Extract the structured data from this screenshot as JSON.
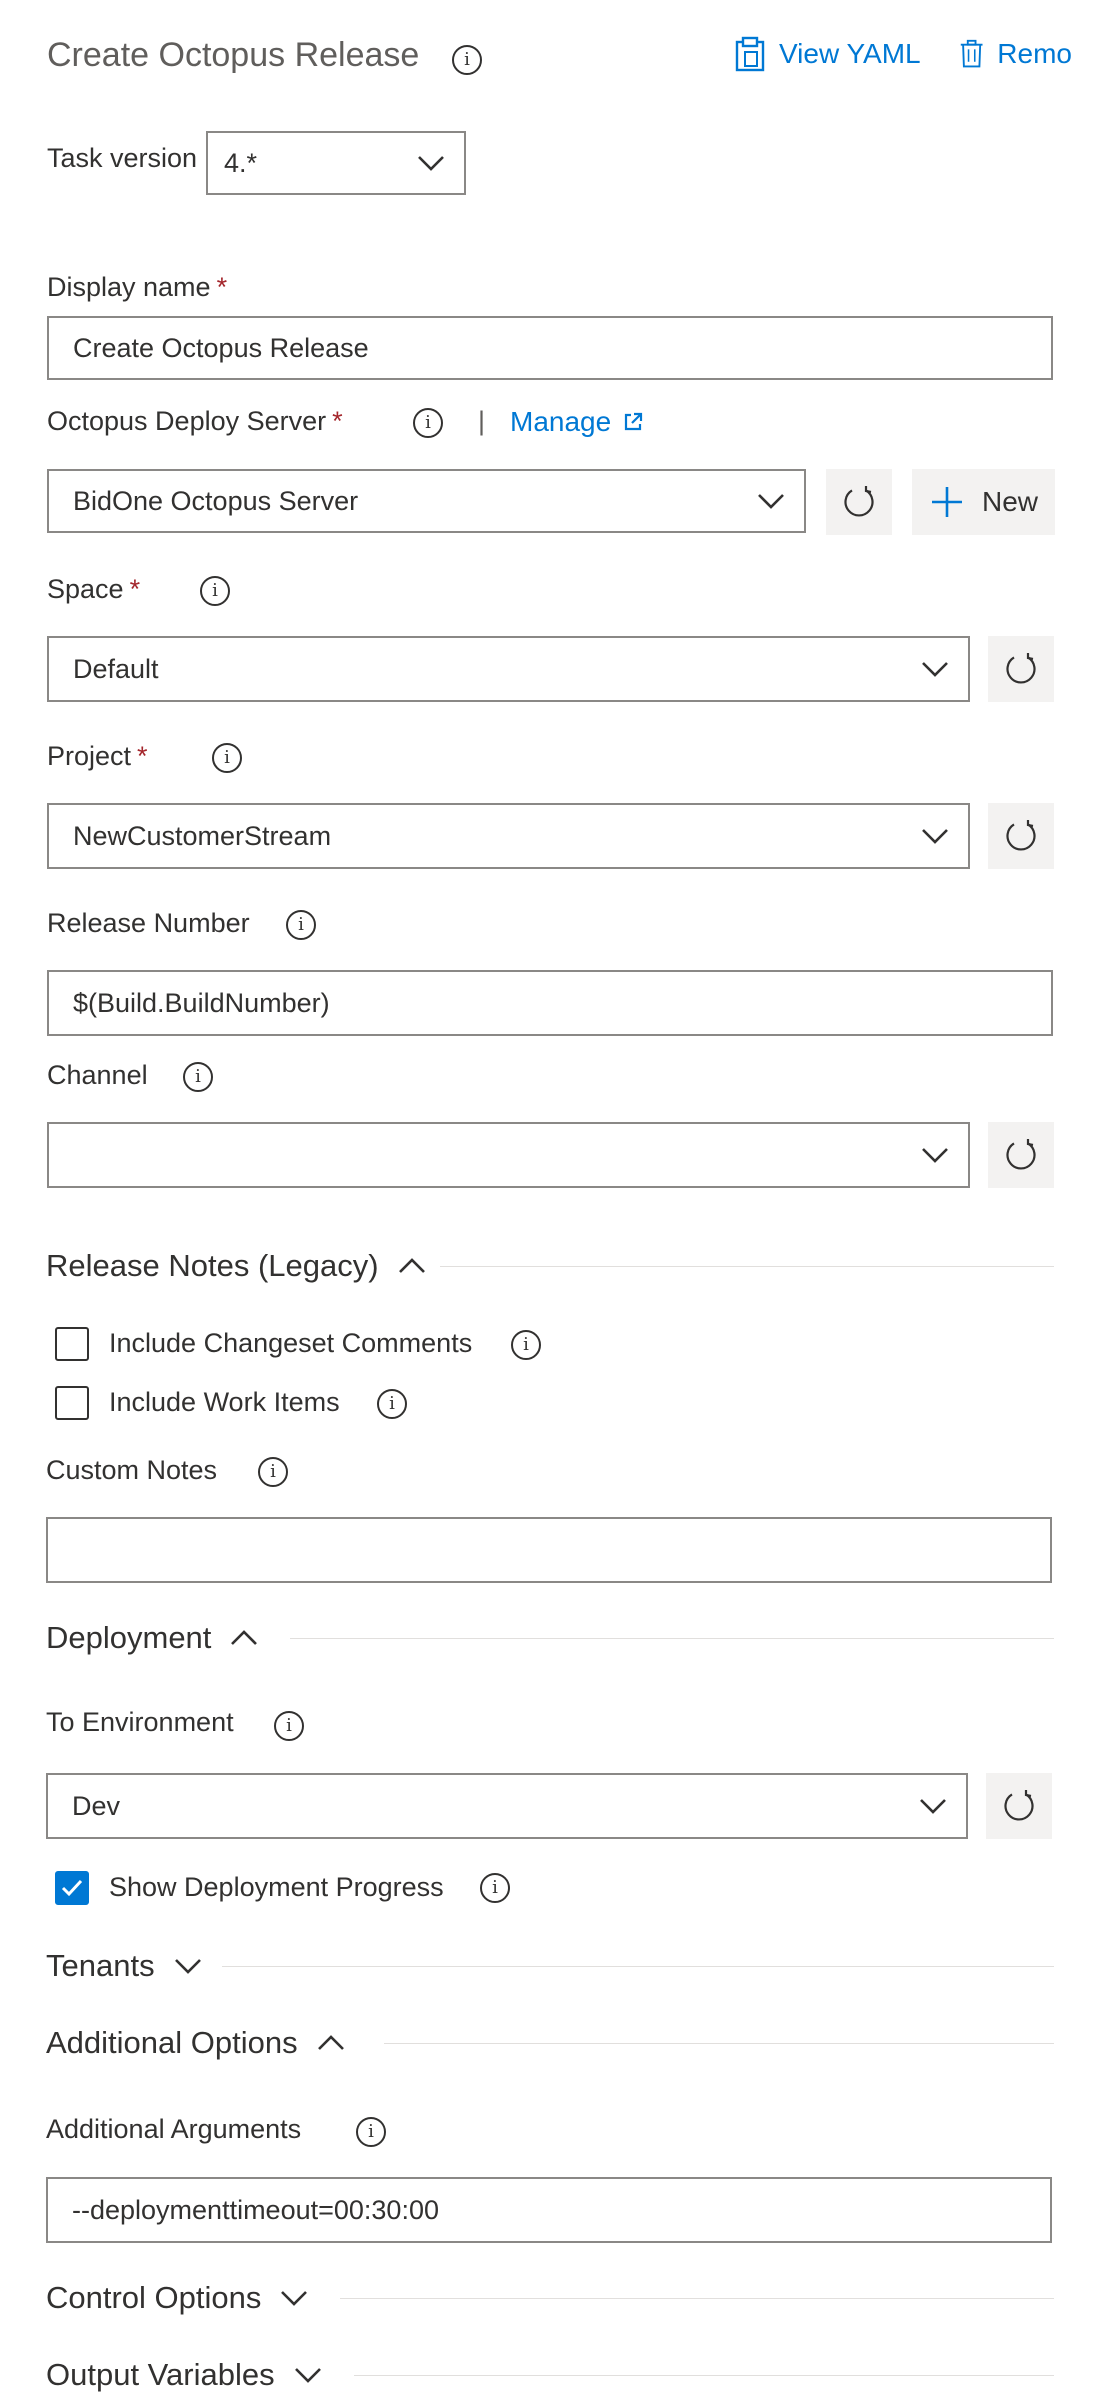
{
  "header": {
    "title": "Create Octopus Release",
    "view_yaml_label": "View YAML",
    "remove_label": "Remo"
  },
  "task_version": {
    "label": "Task version",
    "value": "4.*"
  },
  "display_name": {
    "label": "Display name",
    "required_mark": "*",
    "value": "Create Octopus Release"
  },
  "server": {
    "label": "Octopus Deploy Server",
    "required_mark": "*",
    "separator": "|",
    "manage_label": "Manage",
    "value": "BidOne Octopus Server",
    "new_label": "New"
  },
  "space": {
    "label": "Space",
    "required_mark": "*",
    "value": "Default"
  },
  "project": {
    "label": "Project",
    "required_mark": "*",
    "value": "NewCustomerStream"
  },
  "release_number": {
    "label": "Release Number",
    "value": "$(Build.BuildNumber)"
  },
  "channel": {
    "label": "Channel",
    "value": ""
  },
  "release_notes": {
    "title": "Release Notes (Legacy)",
    "include_changeset": {
      "label": "Include Changeset Comments",
      "checked": false
    },
    "include_work_items": {
      "label": "Include Work Items",
      "checked": false
    },
    "custom_notes": {
      "label": "Custom Notes",
      "value": ""
    }
  },
  "deployment": {
    "title": "Deployment",
    "to_environment": {
      "label": "To Environment",
      "value": "Dev"
    },
    "show_progress": {
      "label": "Show Deployment Progress",
      "checked": true
    }
  },
  "tenants": {
    "title": "Tenants"
  },
  "additional_options": {
    "title": "Additional Options",
    "arguments": {
      "label": "Additional Arguments",
      "value": "--deploymenttimeout=00:30:00"
    }
  },
  "control_options": {
    "title": "Control Options"
  },
  "output_variables": {
    "title": "Output Variables"
  },
  "info_glyph": "i",
  "colors": {
    "accent": "#0078d4",
    "required": "#a4262c",
    "border": "#8a8886",
    "button_bg": "#f3f2f1"
  }
}
